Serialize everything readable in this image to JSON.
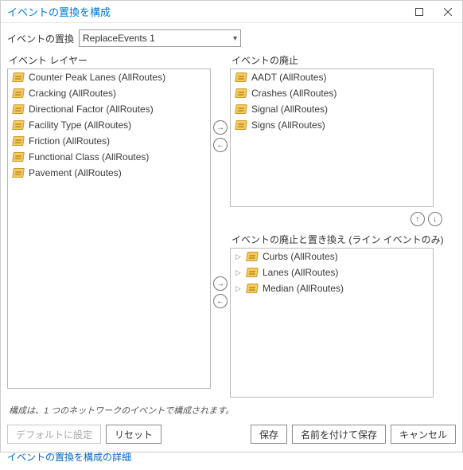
{
  "window": {
    "title": "イベントの置換を構成"
  },
  "topRow": {
    "label": "イベントの置換",
    "selected": "ReplaceEvents 1"
  },
  "leftPanel": {
    "header": "イベント レイヤー",
    "items": [
      "Counter Peak Lanes (AllRoutes)",
      "Cracking (AllRoutes)",
      "Directional Factor (AllRoutes)",
      "Facility Type (AllRoutes)",
      "Friction (AllRoutes)",
      "Functional Class (AllRoutes)",
      "Pavement (AllRoutes)"
    ]
  },
  "rightTop": {
    "header": "イベントの廃止",
    "items": [
      "AADT (AllRoutes)",
      "Crashes (AllRoutes)",
      "Signal (AllRoutes)",
      "Signs (AllRoutes)"
    ]
  },
  "rightBot": {
    "header": "イベントの廃止と置き換え (ライン イベントのみ)",
    "items": [
      "Curbs (AllRoutes)",
      "Lanes (AllRoutes)",
      "Median (AllRoutes)"
    ]
  },
  "note": "構成は、1 つのネットワークのイベントで構成されます。",
  "buttons": {
    "default": "デフォルトに設定",
    "reset": "リセット",
    "save": "保存",
    "saveAs": "名前を付けて保存",
    "cancel": "キャンセル"
  },
  "link": "イベントの置換を構成の詳細"
}
